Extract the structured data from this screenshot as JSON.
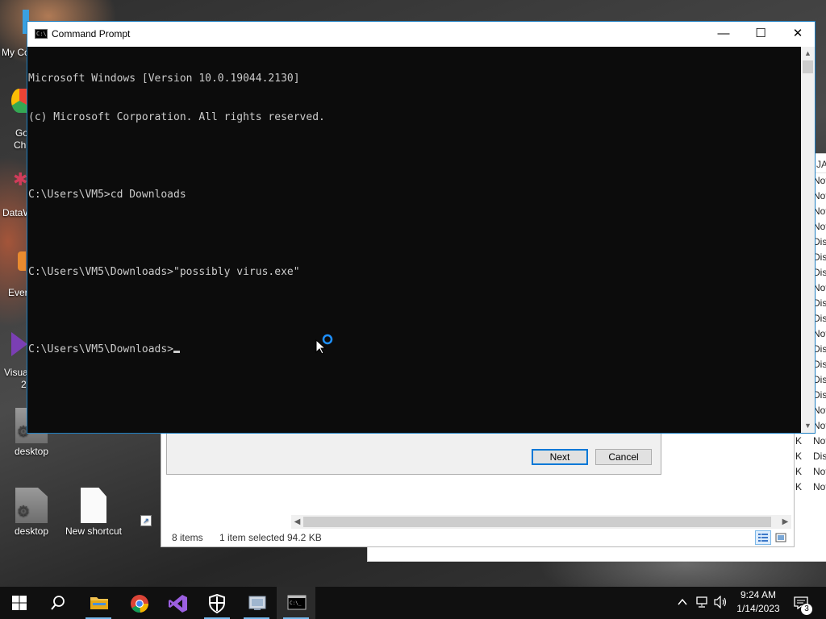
{
  "desktop": {
    "icons": [
      {
        "label": "desktop"
      },
      {
        "label": "desktop"
      },
      {
        "label": "New shortcut"
      }
    ],
    "peek_labels": [
      "My Co",
      "Go",
      "Ch",
      "DataW",
      "Ever",
      "Visua",
      "2"
    ]
  },
  "cmd": {
    "title": "Command Prompt",
    "lines": [
      "Microsoft Windows [Version 10.0.19044.2130]",
      "(c) Microsoft Corporation. All rights reserved.",
      "",
      "C:\\Users\\VM5>cd Downloads",
      "",
      "C:\\Users\\VM5\\Downloads>\"possibly virus.exe\"",
      "",
      "C:\\Users\\VM5\\Downloads>"
    ],
    "controls": {
      "minimize": "—",
      "maximize": "☐",
      "close": "✕"
    }
  },
  "wizard": {
    "next_label": "Next",
    "cancel_label": "Cancel"
  },
  "explorer_status": {
    "items": "8 items",
    "selected": "1 item selected",
    "size": "94.2 KB"
  },
  "background_list": {
    "header": "JA",
    "rows": [
      {
        "k": "",
        "v": "Not"
      },
      {
        "k": "",
        "v": "Not"
      },
      {
        "k": "",
        "v": "Not"
      },
      {
        "k": "",
        "v": "Not"
      },
      {
        "k": "",
        "v": "Dis"
      },
      {
        "k": "",
        "v": "Dis"
      },
      {
        "k": "",
        "v": "Dis"
      },
      {
        "k": "",
        "v": "Not"
      },
      {
        "k": "",
        "v": "Dis"
      },
      {
        "k": "",
        "v": "Dis"
      },
      {
        "k": "",
        "v": "Not"
      },
      {
        "k": "",
        "v": "Dis"
      },
      {
        "k": "",
        "v": "Dis"
      },
      {
        "k": "",
        "v": "Dis"
      },
      {
        "k": "",
        "v": "Dis"
      },
      {
        "k": "K",
        "v": "Not"
      },
      {
        "k": "K",
        "v": "Not"
      },
      {
        "k": "K",
        "v": "Not"
      },
      {
        "k": "K",
        "v": "Dis"
      },
      {
        "k": "K",
        "v": "Not"
      },
      {
        "k": "K",
        "v": "Not"
      }
    ]
  },
  "taskbar": {
    "apps": [
      "start-icon",
      "search-icon",
      "file-explorer-icon",
      "chrome-icon",
      "visual-studio-icon",
      "windows-security-icon",
      "control-panel-icon",
      "command-prompt-icon"
    ],
    "time": "9:24 AM",
    "date": "1/14/2023",
    "notification_count": "3"
  },
  "colors": {
    "accent": "#0078d7",
    "console_bg": "#0c0c0c",
    "console_fg": "#cccccc",
    "taskbar_bg": "#101010"
  }
}
